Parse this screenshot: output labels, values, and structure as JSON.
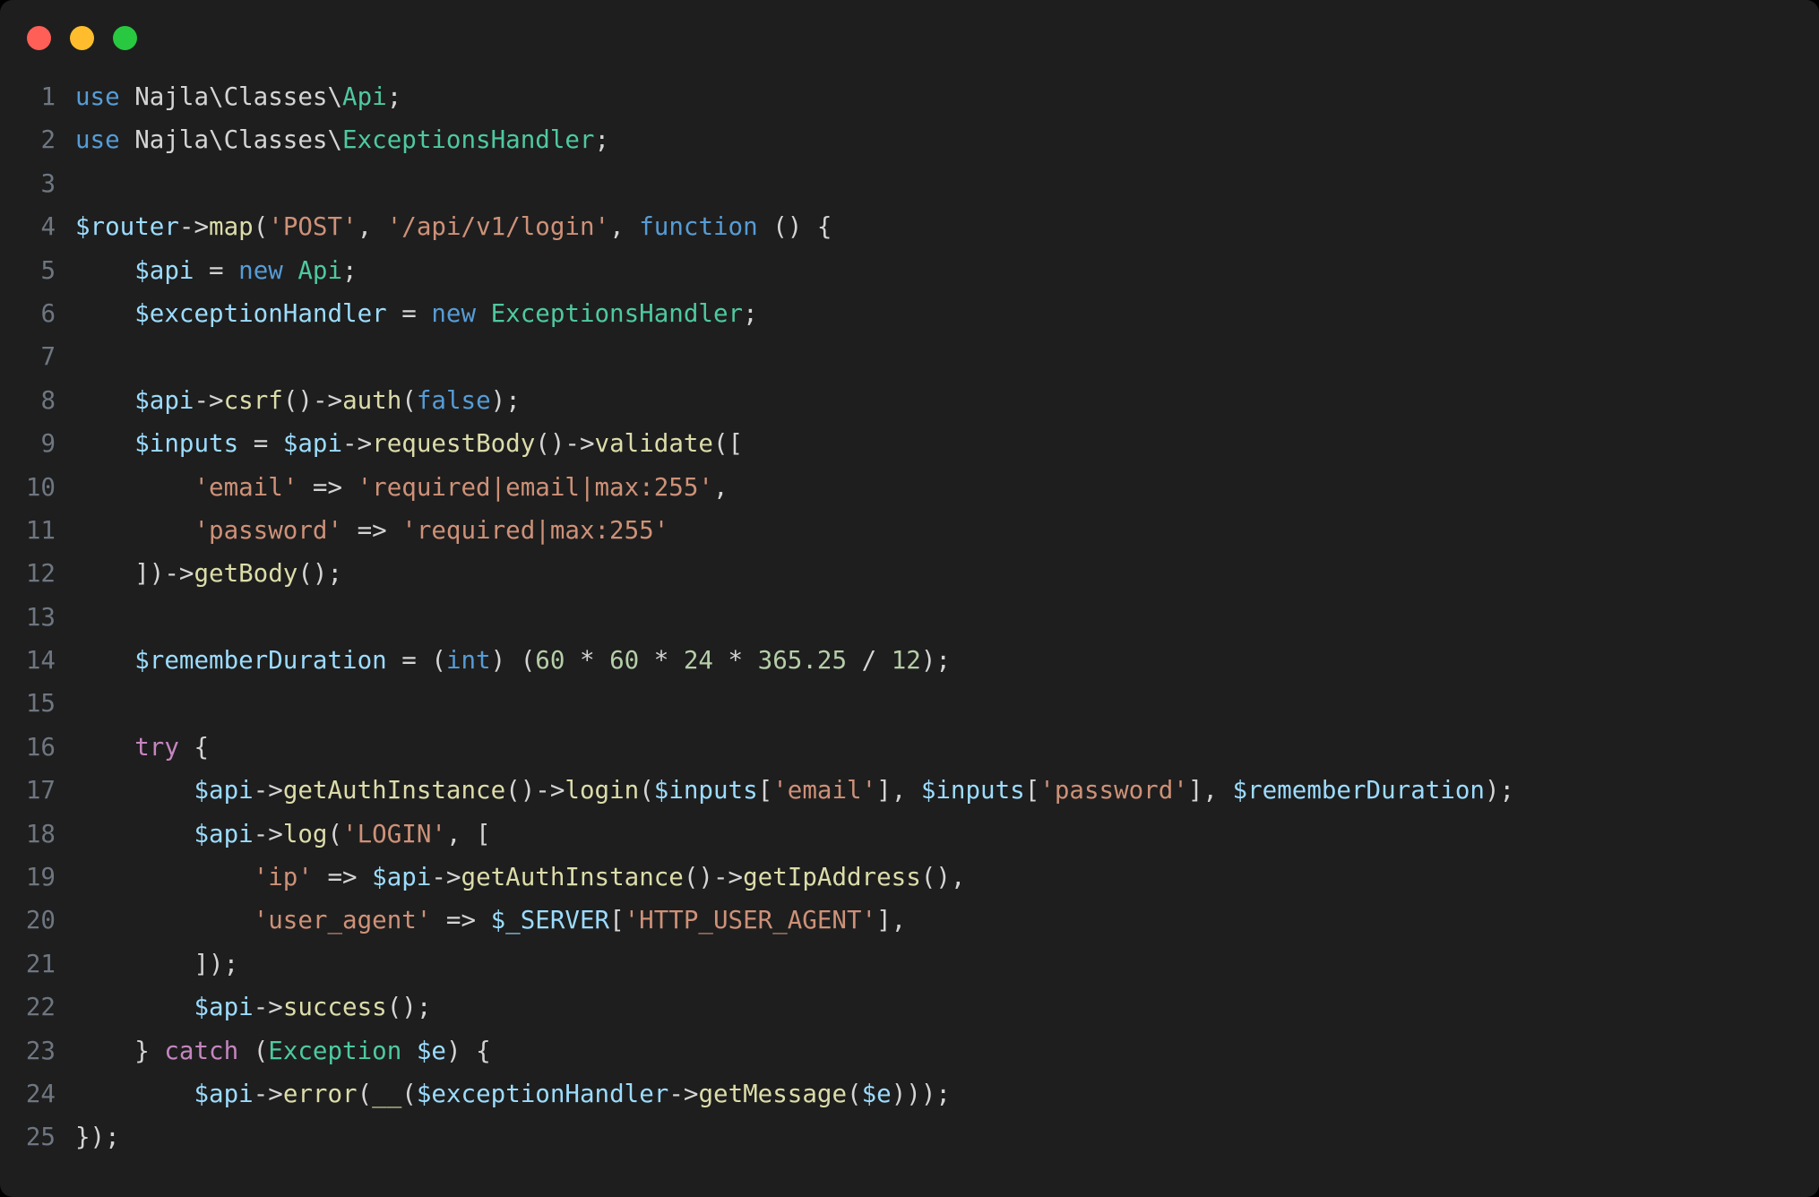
{
  "window": {
    "background_color": "#1e1e1e",
    "page_background_color": "#000000",
    "traffic_lights": [
      {
        "name": "close",
        "color": "#ff5f57"
      },
      {
        "name": "minimize",
        "color": "#ffbd2e"
      },
      {
        "name": "maximize",
        "color": "#28c840"
      }
    ]
  },
  "editor": {
    "language": "PHP",
    "line_number_color": "#6e7681",
    "token_colors": {
      "plain": "#d4d4d4",
      "keyword": "#569cd6",
      "control": "#c586c0",
      "class": "#4ec9a0",
      "variable": "#9cdcfe",
      "function": "#dcdcaa",
      "string": "#ce9178",
      "number": "#b5cea8"
    },
    "line_numbers": [
      "1",
      "2",
      "3",
      "4",
      "5",
      "6",
      "7",
      "8",
      "9",
      "10",
      "11",
      "12",
      "13",
      "14",
      "15",
      "16",
      "17",
      "18",
      "19",
      "20",
      "21",
      "22",
      "23",
      "24",
      "25"
    ],
    "lines": [
      {
        "n": "1",
        "tokens": [
          {
            "t": "kw",
            "v": "use"
          },
          {
            "t": "plain",
            "v": " Najla\\Classes\\"
          },
          {
            "t": "class",
            "v": "Api"
          },
          {
            "t": "plain",
            "v": ";"
          }
        ]
      },
      {
        "n": "2",
        "tokens": [
          {
            "t": "kw",
            "v": "use"
          },
          {
            "t": "plain",
            "v": " Najla\\Classes\\"
          },
          {
            "t": "class",
            "v": "ExceptionsHandler"
          },
          {
            "t": "plain",
            "v": ";"
          }
        ]
      },
      {
        "n": "3",
        "tokens": []
      },
      {
        "n": "4",
        "tokens": [
          {
            "t": "var",
            "v": "$router"
          },
          {
            "t": "plain",
            "v": "->"
          },
          {
            "t": "fn",
            "v": "map"
          },
          {
            "t": "plain",
            "v": "("
          },
          {
            "t": "str",
            "v": "'POST'"
          },
          {
            "t": "plain",
            "v": ", "
          },
          {
            "t": "str",
            "v": "'/api/v1/login'"
          },
          {
            "t": "plain",
            "v": ", "
          },
          {
            "t": "kw",
            "v": "function"
          },
          {
            "t": "plain",
            "v": " () {"
          }
        ]
      },
      {
        "n": "5",
        "tokens": [
          {
            "t": "plain",
            "v": "    "
          },
          {
            "t": "var",
            "v": "$api"
          },
          {
            "t": "plain",
            "v": " = "
          },
          {
            "t": "kw",
            "v": "new"
          },
          {
            "t": "plain",
            "v": " "
          },
          {
            "t": "class",
            "v": "Api"
          },
          {
            "t": "plain",
            "v": ";"
          }
        ]
      },
      {
        "n": "6",
        "tokens": [
          {
            "t": "plain",
            "v": "    "
          },
          {
            "t": "var",
            "v": "$exceptionHandler"
          },
          {
            "t": "plain",
            "v": " = "
          },
          {
            "t": "kw",
            "v": "new"
          },
          {
            "t": "plain",
            "v": " "
          },
          {
            "t": "class",
            "v": "ExceptionsHandler"
          },
          {
            "t": "plain",
            "v": ";"
          }
        ]
      },
      {
        "n": "7",
        "tokens": []
      },
      {
        "n": "8",
        "tokens": [
          {
            "t": "plain",
            "v": "    "
          },
          {
            "t": "var",
            "v": "$api"
          },
          {
            "t": "plain",
            "v": "->"
          },
          {
            "t": "fn",
            "v": "csrf"
          },
          {
            "t": "plain",
            "v": "()->"
          },
          {
            "t": "fn",
            "v": "auth"
          },
          {
            "t": "plain",
            "v": "("
          },
          {
            "t": "kw",
            "v": "false"
          },
          {
            "t": "plain",
            "v": ");"
          }
        ]
      },
      {
        "n": "9",
        "tokens": [
          {
            "t": "plain",
            "v": "    "
          },
          {
            "t": "var",
            "v": "$inputs"
          },
          {
            "t": "plain",
            "v": " = "
          },
          {
            "t": "var",
            "v": "$api"
          },
          {
            "t": "plain",
            "v": "->"
          },
          {
            "t": "fn",
            "v": "requestBody"
          },
          {
            "t": "plain",
            "v": "()->"
          },
          {
            "t": "fn",
            "v": "validate"
          },
          {
            "t": "plain",
            "v": "(["
          }
        ]
      },
      {
        "n": "10",
        "tokens": [
          {
            "t": "plain",
            "v": "        "
          },
          {
            "t": "str",
            "v": "'email'"
          },
          {
            "t": "plain",
            "v": " => "
          },
          {
            "t": "str",
            "v": "'required|email|max:255'"
          },
          {
            "t": "plain",
            "v": ","
          }
        ]
      },
      {
        "n": "11",
        "tokens": [
          {
            "t": "plain",
            "v": "        "
          },
          {
            "t": "str",
            "v": "'password'"
          },
          {
            "t": "plain",
            "v": " => "
          },
          {
            "t": "str",
            "v": "'required|max:255'"
          }
        ]
      },
      {
        "n": "12",
        "tokens": [
          {
            "t": "plain",
            "v": "    ])->"
          },
          {
            "t": "fn",
            "v": "getBody"
          },
          {
            "t": "plain",
            "v": "();"
          }
        ]
      },
      {
        "n": "13",
        "tokens": []
      },
      {
        "n": "14",
        "tokens": [
          {
            "t": "plain",
            "v": "    "
          },
          {
            "t": "var",
            "v": "$rememberDuration"
          },
          {
            "t": "plain",
            "v": " = ("
          },
          {
            "t": "kw",
            "v": "int"
          },
          {
            "t": "plain",
            "v": ") ("
          },
          {
            "t": "num",
            "v": "60"
          },
          {
            "t": "plain",
            "v": " * "
          },
          {
            "t": "num",
            "v": "60"
          },
          {
            "t": "plain",
            "v": " * "
          },
          {
            "t": "num",
            "v": "24"
          },
          {
            "t": "plain",
            "v": " * "
          },
          {
            "t": "num",
            "v": "365.25"
          },
          {
            "t": "plain",
            "v": " / "
          },
          {
            "t": "num",
            "v": "12"
          },
          {
            "t": "plain",
            "v": ");"
          }
        ]
      },
      {
        "n": "15",
        "tokens": []
      },
      {
        "n": "16",
        "tokens": [
          {
            "t": "plain",
            "v": "    "
          },
          {
            "t": "ctrl",
            "v": "try"
          },
          {
            "t": "plain",
            "v": " {"
          }
        ]
      },
      {
        "n": "17",
        "tokens": [
          {
            "t": "plain",
            "v": "        "
          },
          {
            "t": "var",
            "v": "$api"
          },
          {
            "t": "plain",
            "v": "->"
          },
          {
            "t": "fn",
            "v": "getAuthInstance"
          },
          {
            "t": "plain",
            "v": "()->"
          },
          {
            "t": "fn",
            "v": "login"
          },
          {
            "t": "plain",
            "v": "("
          },
          {
            "t": "var",
            "v": "$inputs"
          },
          {
            "t": "plain",
            "v": "["
          },
          {
            "t": "str",
            "v": "'email'"
          },
          {
            "t": "plain",
            "v": "], "
          },
          {
            "t": "var",
            "v": "$inputs"
          },
          {
            "t": "plain",
            "v": "["
          },
          {
            "t": "str",
            "v": "'password'"
          },
          {
            "t": "plain",
            "v": "], "
          },
          {
            "t": "var",
            "v": "$rememberDuration"
          },
          {
            "t": "plain",
            "v": ");"
          }
        ]
      },
      {
        "n": "18",
        "tokens": [
          {
            "t": "plain",
            "v": "        "
          },
          {
            "t": "var",
            "v": "$api"
          },
          {
            "t": "plain",
            "v": "->"
          },
          {
            "t": "fn",
            "v": "log"
          },
          {
            "t": "plain",
            "v": "("
          },
          {
            "t": "str",
            "v": "'LOGIN'"
          },
          {
            "t": "plain",
            "v": ", ["
          }
        ]
      },
      {
        "n": "19",
        "tokens": [
          {
            "t": "plain",
            "v": "            "
          },
          {
            "t": "str",
            "v": "'ip'"
          },
          {
            "t": "plain",
            "v": " => "
          },
          {
            "t": "var",
            "v": "$api"
          },
          {
            "t": "plain",
            "v": "->"
          },
          {
            "t": "fn",
            "v": "getAuthInstance"
          },
          {
            "t": "plain",
            "v": "()->"
          },
          {
            "t": "fn",
            "v": "getIpAddress"
          },
          {
            "t": "plain",
            "v": "(),"
          }
        ]
      },
      {
        "n": "20",
        "tokens": [
          {
            "t": "plain",
            "v": "            "
          },
          {
            "t": "str",
            "v": "'user_agent'"
          },
          {
            "t": "plain",
            "v": " => "
          },
          {
            "t": "var",
            "v": "$_SERVER"
          },
          {
            "t": "plain",
            "v": "["
          },
          {
            "t": "str",
            "v": "'HTTP_USER_AGENT'"
          },
          {
            "t": "plain",
            "v": "],"
          }
        ]
      },
      {
        "n": "21",
        "tokens": [
          {
            "t": "plain",
            "v": "        ]);"
          }
        ]
      },
      {
        "n": "22",
        "tokens": [
          {
            "t": "plain",
            "v": "        "
          },
          {
            "t": "var",
            "v": "$api"
          },
          {
            "t": "plain",
            "v": "->"
          },
          {
            "t": "fn",
            "v": "success"
          },
          {
            "t": "plain",
            "v": "();"
          }
        ]
      },
      {
        "n": "23",
        "tokens": [
          {
            "t": "plain",
            "v": "    } "
          },
          {
            "t": "ctrl",
            "v": "catch"
          },
          {
            "t": "plain",
            "v": " ("
          },
          {
            "t": "class",
            "v": "Exception"
          },
          {
            "t": "plain",
            "v": " "
          },
          {
            "t": "var",
            "v": "$e"
          },
          {
            "t": "plain",
            "v": ") {"
          }
        ]
      },
      {
        "n": "24",
        "tokens": [
          {
            "t": "plain",
            "v": "        "
          },
          {
            "t": "var",
            "v": "$api"
          },
          {
            "t": "plain",
            "v": "->"
          },
          {
            "t": "fn",
            "v": "error"
          },
          {
            "t": "plain",
            "v": "("
          },
          {
            "t": "fn",
            "v": "__"
          },
          {
            "t": "plain",
            "v": "("
          },
          {
            "t": "var",
            "v": "$exceptionHandler"
          },
          {
            "t": "plain",
            "v": "->"
          },
          {
            "t": "fn",
            "v": "getMessage"
          },
          {
            "t": "plain",
            "v": "("
          },
          {
            "t": "var",
            "v": "$e"
          },
          {
            "t": "plain",
            "v": ")));"
          }
        ]
      },
      {
        "n": "25",
        "tokens": [
          {
            "t": "plain",
            "v": "});"
          }
        ]
      }
    ]
  }
}
